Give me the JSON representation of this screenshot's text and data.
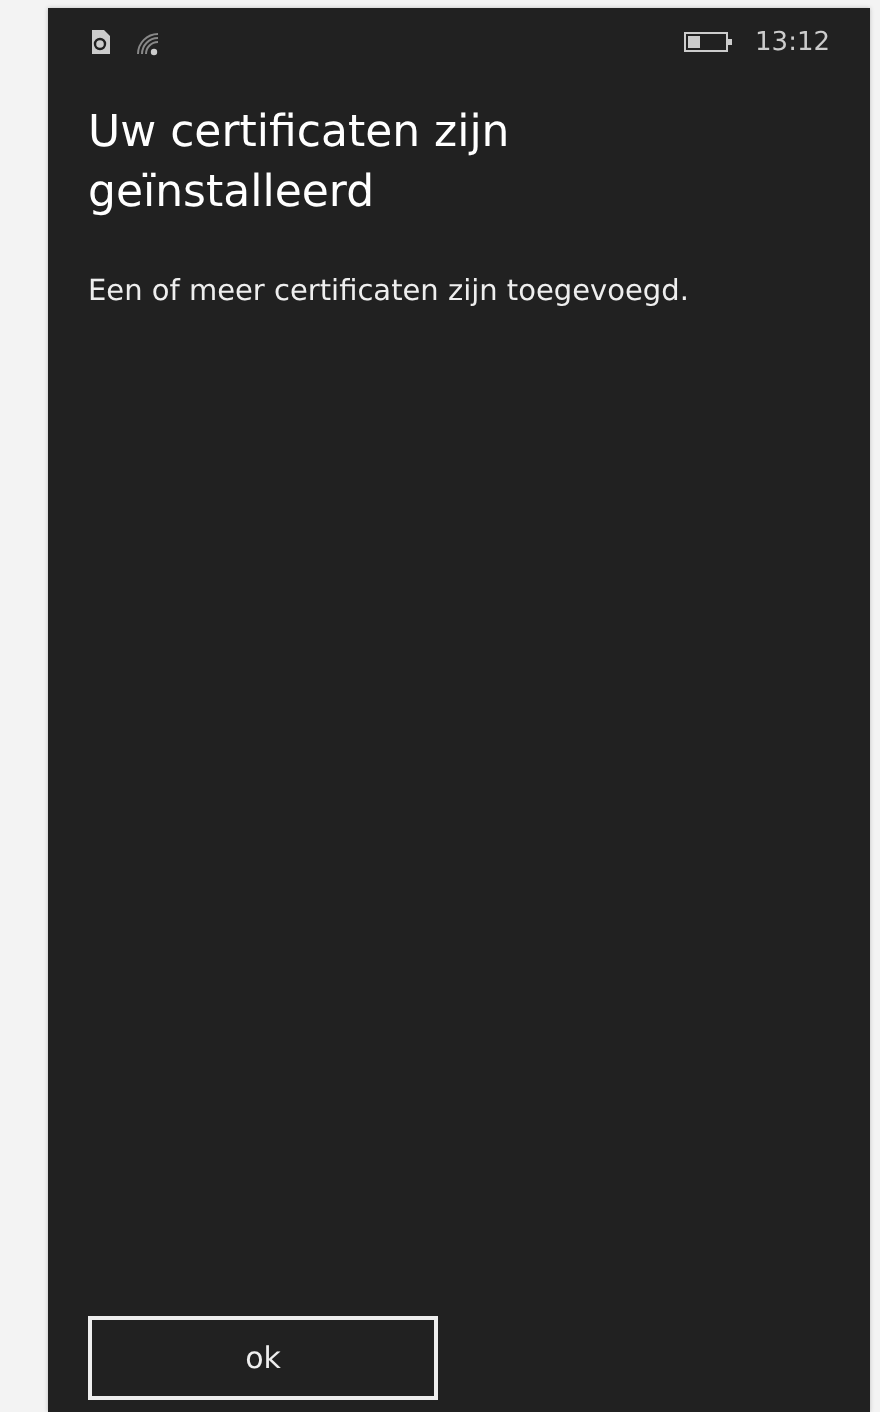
{
  "status_bar": {
    "time": "13:12"
  },
  "dialog": {
    "title": "Uw certificaten zijn geïnstalleerd",
    "message": "Een of meer certificaten zijn toegevoegd."
  },
  "buttons": [
    {
      "label": "ok"
    }
  ]
}
